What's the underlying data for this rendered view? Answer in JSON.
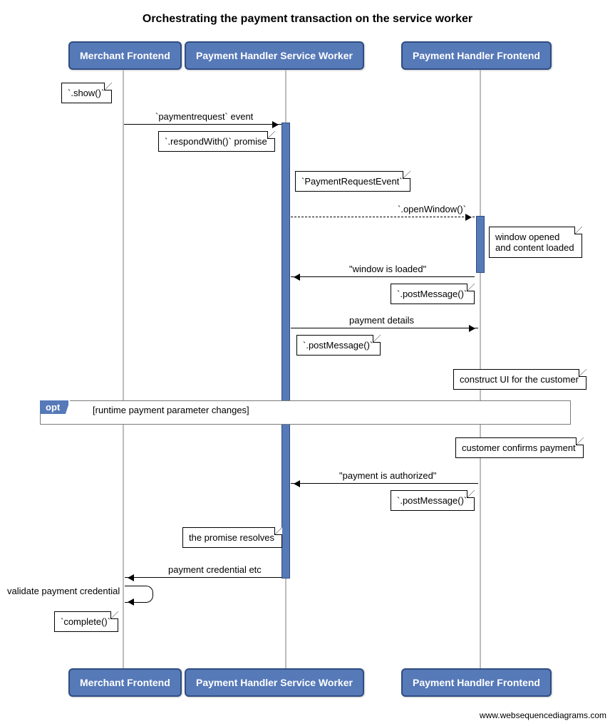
{
  "title": "Orchestrating the payment transaction on the service worker",
  "actors": {
    "merchant": "Merchant Frontend",
    "sw": "Payment Handler Service Worker",
    "frontend": "Payment Handler Frontend"
  },
  "labels": {
    "show": "`.show()`",
    "paymentrequest_event": "`paymentrequest` event",
    "respondWith": "`.respondWith()` promise",
    "pre_evt": "`PaymentRequestEvent`",
    "openWindow": "`.openWindow()`",
    "window_opened": "window opened\nand content loaded",
    "window_loaded": "\"window is loaded\"",
    "postMessage": "`.postMessage()`",
    "payment_details": "payment details",
    "construct_ui": "construct UI for the customer",
    "opt": "opt",
    "opt_cond": "[runtime payment parameter changes]",
    "customer_confirms": "customer confirms payment",
    "payment_authorized": "\"payment is authorized\"",
    "promise_resolves": "the promise resolves",
    "payment_credential": "payment credential etc",
    "validate": "validate payment credential",
    "complete": "`complete()`"
  },
  "footer": "www.websequencediagrams.com"
}
